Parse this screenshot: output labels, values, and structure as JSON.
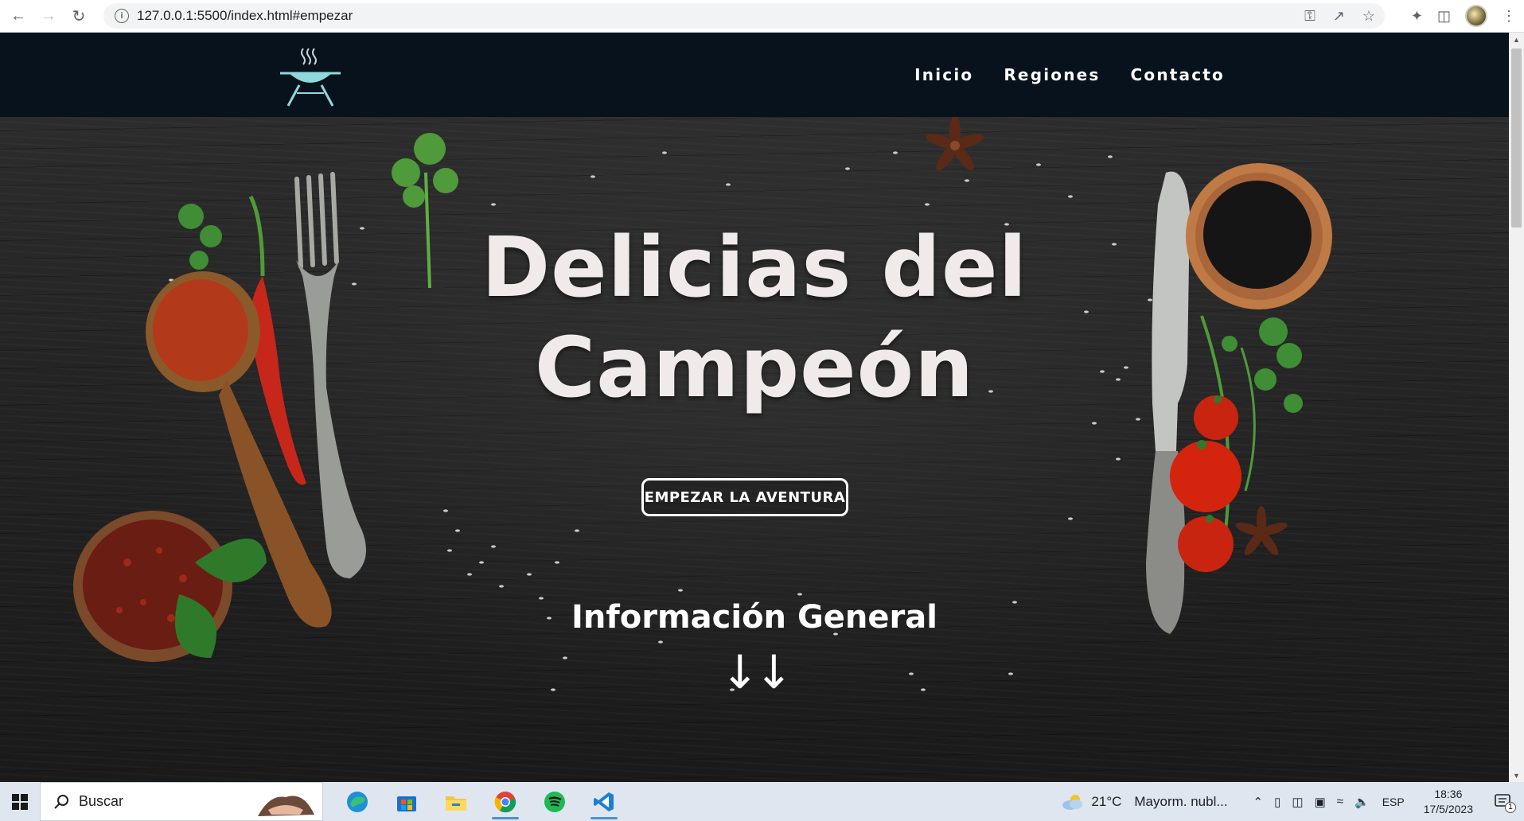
{
  "browser": {
    "url": "127.0.0.1:5500/index.html#empezar"
  },
  "site": {
    "nav": [
      {
        "label": "Inicio"
      },
      {
        "label": "Regiones"
      },
      {
        "label": "Contacto"
      }
    ],
    "hero": {
      "title_line1": "Delicias del",
      "title_line2": "Campeón",
      "cta_label": "EMPEZAR LA AVENTURA",
      "info_title": "Información General",
      "arrows": "↓↓"
    }
  },
  "taskbar": {
    "search_placeholder": "Buscar",
    "weather_temp": "21°C",
    "weather_desc": "Mayorm. nubl...",
    "language": "ESP",
    "time": "18:36",
    "date": "17/5/2023",
    "notification_count": "1"
  },
  "colors": {
    "header_bg": "#07121c",
    "logo_accent": "#8fd8dc",
    "taskbar_bg": "#dfe6ef"
  }
}
